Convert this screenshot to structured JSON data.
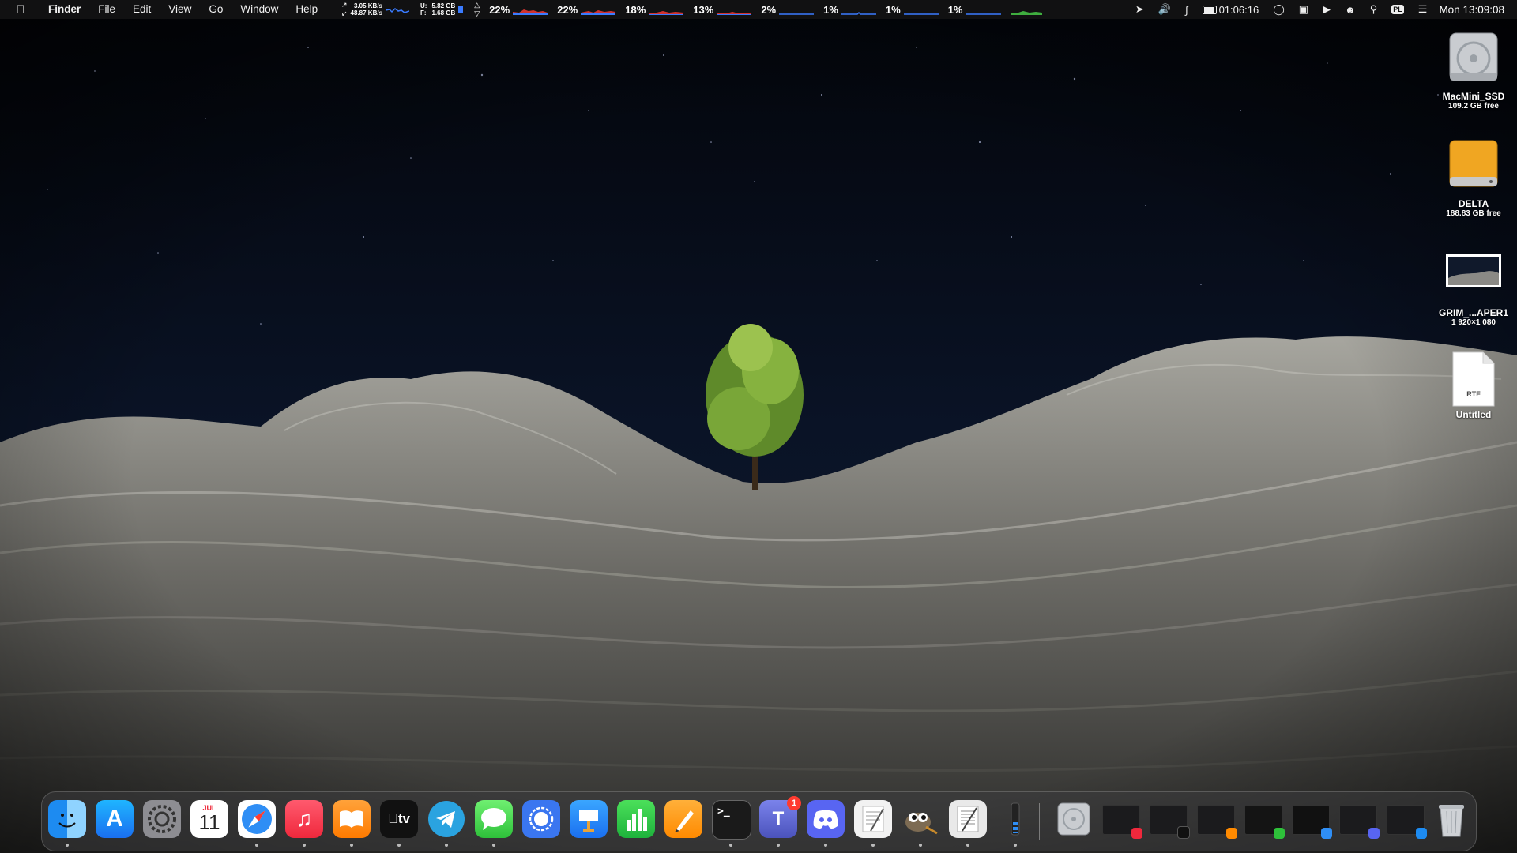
{
  "menubar": {
    "apple_icon": "apple-logo-icon",
    "app_name": "Finder",
    "menus": [
      "File",
      "Edit",
      "View",
      "Go",
      "Window",
      "Help"
    ],
    "network": {
      "up": "3.05 KB/s",
      "down": "48.87 KB/s"
    },
    "memory": {
      "u_label": "U:",
      "u_value": "5.82 GB",
      "f_label": "F:",
      "f_value": "1.68 GB"
    },
    "cpu_percents": [
      "22%",
      "22%",
      "18%",
      "13%",
      "2%",
      "1%",
      "1%",
      "1%"
    ],
    "battery_time": "01:06:16",
    "input_language": "PL",
    "clock": "Mon 13:09:08",
    "icons": [
      "telegram-send-icon",
      "volume-icon",
      "bluetooth-icon",
      "battery-icon",
      "airdrop-icon",
      "cast-icon",
      "play-icon",
      "user-icon",
      "spotlight-search-icon",
      "control-center-icon"
    ]
  },
  "desktop": {
    "icons": [
      {
        "label": "MacMini_SSD",
        "sub": "109.2 GB free",
        "icon": "hard-drive-icon"
      },
      {
        "label": "DELTA",
        "sub": "188.83 GB free",
        "icon": "external-drive-icon"
      },
      {
        "label": "GRIM_...APER1",
        "sub": "1 920×1 080",
        "icon": "image-file-icon"
      },
      {
        "label": "Untitled",
        "sub": "",
        "icon": "rtf-document-icon",
        "doc_tag": "RTF"
      }
    ]
  },
  "dock": {
    "apps": [
      {
        "name": "Finder",
        "icon": "finder-icon",
        "running": true
      },
      {
        "name": "App Store",
        "icon": "app-store-icon",
        "running": false
      },
      {
        "name": "System Preferences",
        "icon": "system-preferences-icon",
        "running": false
      },
      {
        "name": "Calendar",
        "icon": "calendar-icon",
        "running": false,
        "month": "JUL",
        "day": "11"
      },
      {
        "name": "Safari",
        "icon": "safari-icon",
        "running": true
      },
      {
        "name": "Music",
        "icon": "music-icon",
        "running": true
      },
      {
        "name": "Books",
        "icon": "books-icon",
        "running": true
      },
      {
        "name": "TV",
        "icon": "apple-tv-icon",
        "running": true,
        "text": "tv"
      },
      {
        "name": "Telegram",
        "icon": "telegram-icon",
        "running": true
      },
      {
        "name": "Messages",
        "icon": "messages-icon",
        "running": true
      },
      {
        "name": "Signal",
        "icon": "signal-icon",
        "running": false
      },
      {
        "name": "Keynote",
        "icon": "keynote-icon",
        "running": false
      },
      {
        "name": "Numbers",
        "icon": "numbers-icon",
        "running": false
      },
      {
        "name": "Pages",
        "icon": "pages-icon",
        "running": false
      },
      {
        "name": "Terminal",
        "icon": "terminal-icon",
        "running": true,
        "text": ">_"
      },
      {
        "name": "Microsoft Teams",
        "icon": "teams-icon",
        "running": true,
        "badge": "1"
      },
      {
        "name": "Discord",
        "icon": "discord-icon",
        "running": true
      },
      {
        "name": "TextEdit",
        "icon": "textedit-icon",
        "running": true
      },
      {
        "name": "GIMP",
        "icon": "gimp-icon",
        "running": true
      },
      {
        "name": "Script Editor",
        "icon": "script-editor-icon",
        "running": true
      },
      {
        "name": "iStat Menus",
        "icon": "istat-menus-icon",
        "running": true
      }
    ],
    "minimized": [
      {
        "name": "Disk Utility",
        "icon": "disk-utility-icon"
      },
      {
        "name": "Music window",
        "icon": "music-window-thumbnail-icon"
      },
      {
        "name": "TV window",
        "icon": "tv-window-thumbnail-icon"
      },
      {
        "name": "Books window",
        "icon": "books-window-thumbnail-icon"
      },
      {
        "name": "Messages window",
        "icon": "messages-window-thumbnail-icon"
      },
      {
        "name": "Safari window",
        "icon": "safari-window-thumbnail-icon"
      },
      {
        "name": "Discord window",
        "icon": "discord-window-thumbnail-icon"
      },
      {
        "name": "Finder window",
        "icon": "finder-window-thumbnail-icon"
      },
      {
        "name": "Trash",
        "icon": "trash-icon"
      }
    ]
  }
}
